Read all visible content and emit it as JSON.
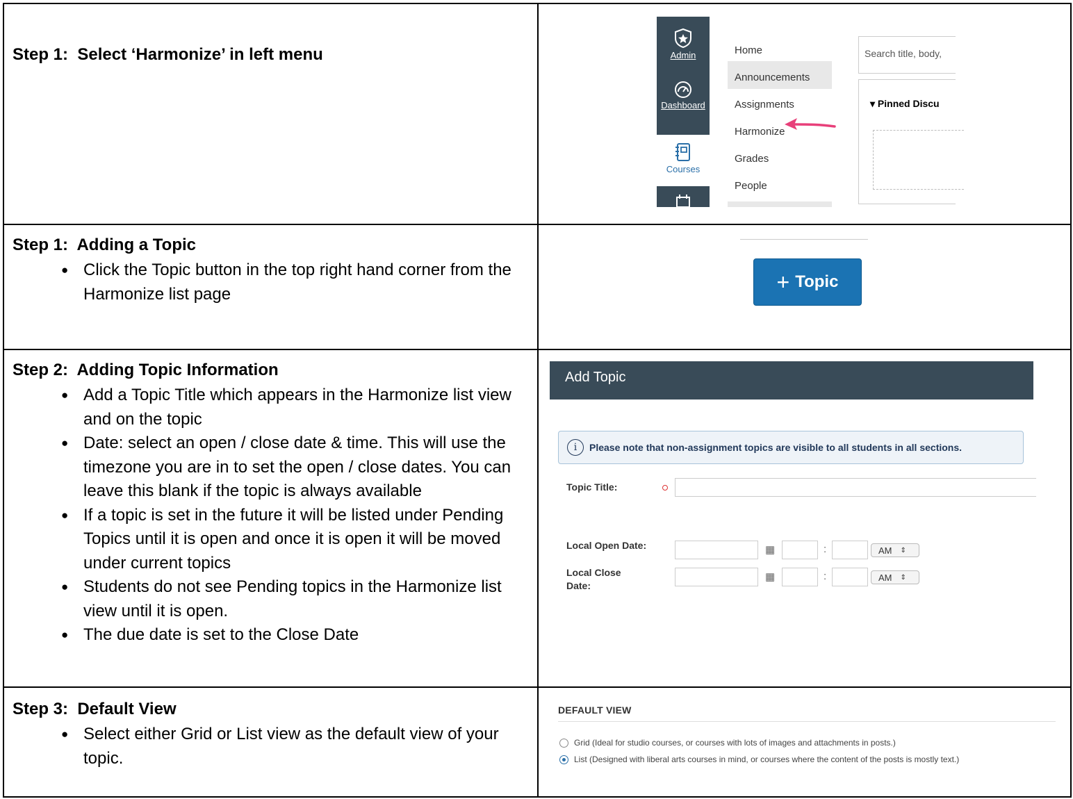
{
  "rows": [
    {
      "title": "Step 1:  Select ‘Harmonize’ in left menu",
      "bullets": []
    },
    {
      "title": "Step 1:  Adding a Topic",
      "bullets": [
        "Click the Topic button in the top right hand corner from the Harmonize list page"
      ]
    },
    {
      "title": "Step 2:  Adding Topic Information",
      "bullets": [
        "Add a Topic Title which appears in the Harmonize list view and on the topic",
        "Date:  select an open / close date & time.  This will use the timezone you are in to set the open / close dates.  You can leave this blank if the topic is always available",
        "If a topic is set in the future it will be listed under Pending Topics until it is open and once it is open it will be moved under current topics",
        "Students do not see Pending topics in the Harmonize list view until it is open.",
        "The due date is set to the Close Date"
      ]
    },
    {
      "title": "Step 3:  Default View",
      "bullets": [
        "Select either Grid or List view as the default view of your topic."
      ]
    }
  ],
  "screenshot1": {
    "global_nav": [
      {
        "label": "Admin",
        "icon": "shield-star-icon"
      },
      {
        "label": "Dashboard",
        "icon": "speedometer-icon"
      },
      {
        "label": "Courses",
        "icon": "book-icon"
      }
    ],
    "course_nav": [
      "Home",
      "Announcements",
      "Assignments",
      "Harmonize",
      "Grades",
      "People"
    ],
    "search_placeholder": "Search title, body,",
    "pinned_label": "Pinned Discu",
    "arrow_color": "#e8407a"
  },
  "screenshot2": {
    "button_label": "Topic",
    "button_color": "#1b73b3"
  },
  "screenshot3": {
    "header": "Add Topic",
    "note": "Please note that non-assignment topics are visible to all students in all sections.",
    "topic_title_label": "Topic Title:",
    "open_date_label": "Local Open Date:",
    "close_date_label": "Local Close Date:",
    "ampm_value": "AM",
    "colon": ":"
  },
  "screenshot4": {
    "section_title": "DEFAULT VIEW",
    "options": [
      {
        "label": "Grid (Ideal for studio courses, or courses with lots of images and attachments in posts.)",
        "selected": false
      },
      {
        "label": "List (Designed with liberal arts courses in mind, or courses where the content of the posts is mostly text.)",
        "selected": true
      }
    ]
  }
}
